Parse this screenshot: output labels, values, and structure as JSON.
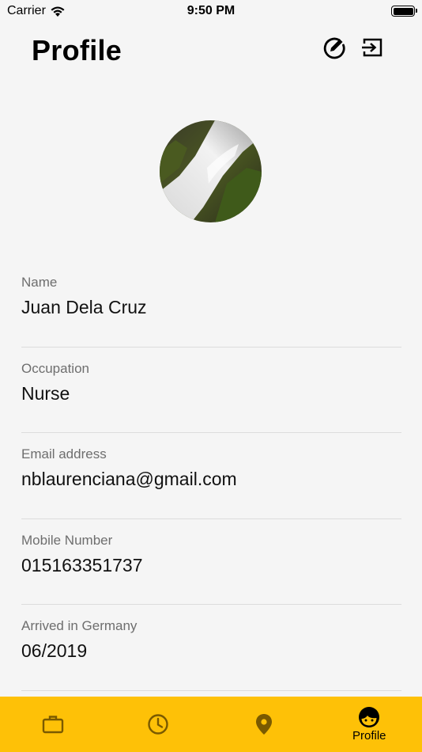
{
  "status_bar": {
    "carrier": "Carrier",
    "time": "9:50 PM"
  },
  "header": {
    "title": "Profile",
    "edit_icon": "edit-circle-icon",
    "logout_icon": "logout-icon"
  },
  "profile": {
    "fields": [
      {
        "label": "Name",
        "value": "Juan Dela Cruz"
      },
      {
        "label": "Occupation",
        "value": "Nurse"
      },
      {
        "label": "Email address",
        "value": "nblaurenciana@gmail.com"
      },
      {
        "label": "Mobile Number",
        "value": "015163351737"
      },
      {
        "label": "Arrived in Germany",
        "value": "06/2019"
      }
    ]
  },
  "tab_bar": {
    "accent": "#fec107",
    "icon_color": "#7a5a00",
    "tabs": [
      {
        "icon": "briefcase-icon",
        "label": ""
      },
      {
        "icon": "clock-icon",
        "label": ""
      },
      {
        "icon": "location-pin-icon",
        "label": ""
      },
      {
        "icon": "face-icon",
        "label": "Profile",
        "selected": true
      }
    ]
  }
}
